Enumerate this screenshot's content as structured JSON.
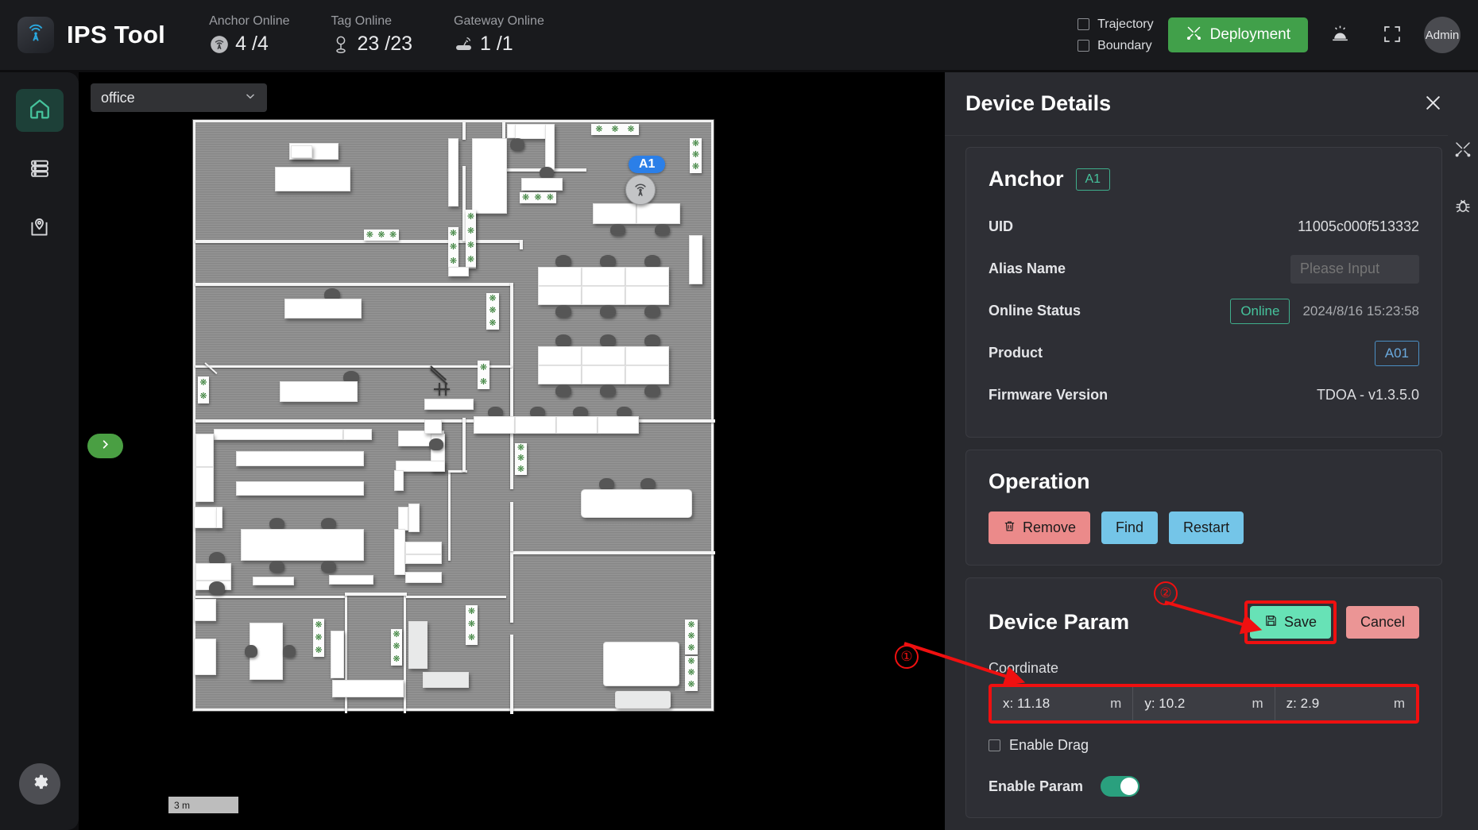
{
  "header": {
    "brand": "IPS Tool",
    "logo_icon": "signal-tower-icon",
    "stats": [
      {
        "label": "Anchor Online",
        "value": "4 /4",
        "icon": "anchor-icon"
      },
      {
        "label": "Tag Online",
        "value": "23 /23",
        "icon": "tag-pin-icon"
      },
      {
        "label": "Gateway Online",
        "value": "1 /1",
        "icon": "gateway-icon"
      }
    ],
    "checkboxes": [
      {
        "label": "Trajectory",
        "checked": false
      },
      {
        "label": "Boundary",
        "checked": false
      }
    ],
    "deploy_label": "Deployment",
    "deploy_icon": "tools-icon",
    "alarm_icon": "alarm-icon",
    "fullscreen_icon": "fullscreen-icon",
    "avatar_label": "Admin"
  },
  "rail": {
    "items": [
      {
        "name": "home",
        "icon": "home-icon",
        "active": true
      },
      {
        "name": "devices",
        "icon": "server-icon",
        "active": false
      },
      {
        "name": "map",
        "icon": "map-pin-icon",
        "active": false
      }
    ],
    "settings_icon": "gear-icon"
  },
  "map": {
    "floor_selected": "office",
    "chevron_icon": "chevron-down-icon",
    "expand_icon": "chevron-right-icon",
    "scale_label": "3 m",
    "anchor_marker": {
      "label": "A1",
      "icon": "anchor-signal-icon"
    }
  },
  "panel": {
    "title": "Device Details",
    "close_icon": "close-icon",
    "device": {
      "type": "Anchor",
      "tag": "A1",
      "fields": [
        {
          "label": "UID",
          "value": "11005c000f513332"
        },
        {
          "label": "Alias Name",
          "value": "",
          "placeholder": "Please Input"
        },
        {
          "label": "Online Status",
          "status": "Online",
          "timestamp": "2024/8/16 15:23:58"
        },
        {
          "label": "Product",
          "badge": "A01"
        },
        {
          "label": "Firmware Version",
          "value": "TDOA - v1.3.5.0"
        }
      ]
    },
    "operation": {
      "title": "Operation",
      "buttons": [
        {
          "label": "Remove",
          "icon": "trash-icon"
        },
        {
          "label": "Find",
          "icon": ""
        },
        {
          "label": "Restart",
          "icon": ""
        }
      ]
    },
    "device_param": {
      "title": "Device Param",
      "save_label": "Save",
      "save_icon": "save-icon",
      "cancel_label": "Cancel",
      "coordinate_label": "Coordinate",
      "coordinate": [
        {
          "axis": "x:",
          "value": "11.18",
          "unit": "m"
        },
        {
          "axis": "y:",
          "value": "10.2",
          "unit": "m"
        },
        {
          "axis": "z:",
          "value": "2.9",
          "unit": "m"
        }
      ],
      "enable_drag_label": "Enable Drag",
      "enable_drag": false,
      "enable_param_label": "Enable Param",
      "enable_param": true
    },
    "side_tools": [
      {
        "name": "tools",
        "icon": "tools-icon"
      },
      {
        "name": "debug",
        "icon": "bug-icon"
      }
    ]
  },
  "annotations": [
    {
      "number": "①",
      "target": "coordinate-input-group"
    },
    {
      "number": "②",
      "target": "save-button"
    }
  ],
  "colors": {
    "accent_green": "#41a04a",
    "teal": "#46c39c",
    "blue": "#2b7fe8",
    "highlight_red": "#f01010",
    "panel_bg": "#2a2b30",
    "header_bg": "#191a1d"
  }
}
